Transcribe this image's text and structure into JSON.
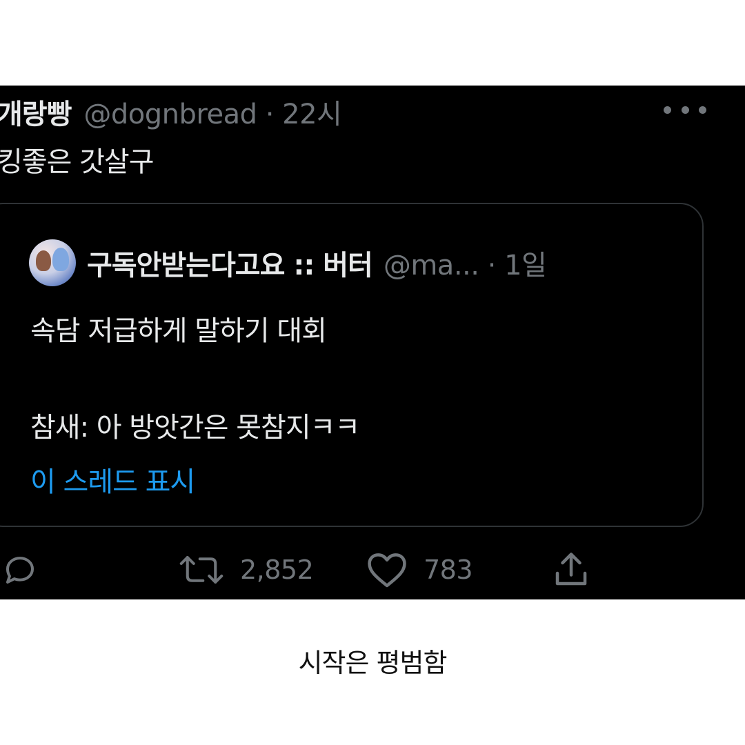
{
  "tweet": {
    "display_name": "개랑빵",
    "meta": "@dognbread · 22시",
    "more_icon": "more-horizontal-icon",
    "text": "킹좋은 갓살구",
    "quote": {
      "avatar": "avatar-image",
      "display_name": "구독안받는다고요 :: 버터",
      "meta": "@ma... · 1일",
      "body_lines": [
        "속담 저급하게 말하기 대회",
        "",
        "참새: 아 방앗간은 못참지ㅋㅋ"
      ],
      "show_thread": "이 스레드 표시",
      "link_color": "#1d9bf0"
    },
    "actions": {
      "reply_icon": "reply-icon",
      "retweet_icon": "retweet-icon",
      "retweet_count": "2,852",
      "like_icon": "heart-icon",
      "like_count": "783",
      "share_icon": "share-icon"
    }
  },
  "caption": "시작은 평범함",
  "colors": {
    "background": "#000000",
    "text": "#e7e9ea",
    "muted": "#71767b",
    "border": "#2f3336"
  }
}
